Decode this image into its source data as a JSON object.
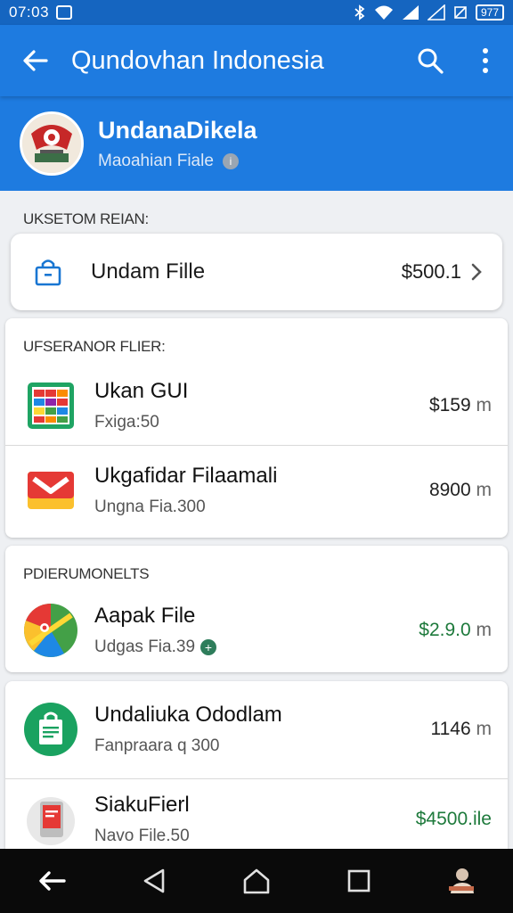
{
  "status_bar": {
    "time": "07:03",
    "battery": "977"
  },
  "app_bar": {
    "title": "Qundovhan Indonesia"
  },
  "profile": {
    "name": "UndanaDikela",
    "subtitle": "Maoahian Fiale"
  },
  "top_section": {
    "header": "UKSETOM REIAN:",
    "item": {
      "label": "Undam Fille",
      "price": "$500.1"
    }
  },
  "section_one": {
    "header": "UFSERANOR FLIER:",
    "items": [
      {
        "title": "Ukan GUI",
        "subtitle": "Fxiga:50",
        "amount": "$159",
        "unit": "m"
      },
      {
        "title": "Ukgafidar Filaamali",
        "subtitle": "Ungna Fia.300",
        "amount": "8900",
        "unit": "m"
      }
    ]
  },
  "section_two": {
    "header": "PDIERUMONELTS",
    "items": [
      {
        "title": "Aapak File",
        "subtitle": "Udgas Fia.39",
        "amount": "$2.9.0",
        "unit": "m"
      }
    ]
  },
  "section_three": {
    "items": [
      {
        "title": "Undaliuka Ododlam",
        "subtitle": "Fanpraara q 300",
        "amount": "1146",
        "unit": "m"
      },
      {
        "title": "SiakuFierl",
        "subtitle": "Navo File.50",
        "amount": "$4500.ile"
      }
    ]
  },
  "icons": {
    "back": "arrow-back-icon",
    "search": "search-icon",
    "more": "more-vert-icon"
  },
  "colors": {
    "primary": "#1e7be0",
    "status_bar": "#1565c0",
    "positive_amount": "#1e7a3c"
  }
}
